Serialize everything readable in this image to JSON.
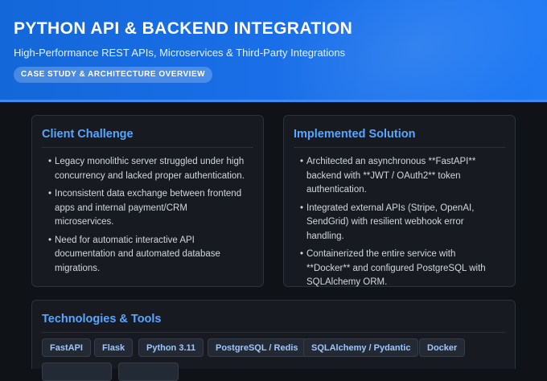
{
  "header": {
    "title": "PYTHON API & BACKEND INTEGRATION",
    "subtitle": "High-Performance REST APIs, Microservices & Third-Party Integrations",
    "badge": "CASE STUDY & ARCHITECTURE OVERVIEW"
  },
  "challenge": {
    "title": "Client Challenge",
    "items": [
      "Legacy monolithic server struggled under high concurrency and lacked proper authentication.",
      "Inconsistent data exchange between frontend apps and internal payment/CRM microservices.",
      "Need for automatic interactive API documentation and automated database migrations."
    ]
  },
  "solution": {
    "title": "Implemented Solution",
    "items": [
      "Architected an asynchronous **FastAPI** backend with **JWT / OAuth2** token authentication.",
      "Integrated external APIs (Stripe, OpenAI, SendGrid) with resilient webhook error handling.",
      "Containerized the entire service with **Docker** and configured PostgreSQL with SQLAlchemy ORM."
    ]
  },
  "technologies": {
    "title": "Technologies & Tools",
    "tags": [
      "FastAPI",
      "Flask",
      "Python 3.11",
      "PostgreSQL / Redis",
      "SQLAlchemy / Pydantic",
      "Docker"
    ]
  },
  "colors": {
    "header_blue": "#1a6fe8",
    "accent": "#58a6ff",
    "background": "#0f1216",
    "card": "#171b21"
  }
}
